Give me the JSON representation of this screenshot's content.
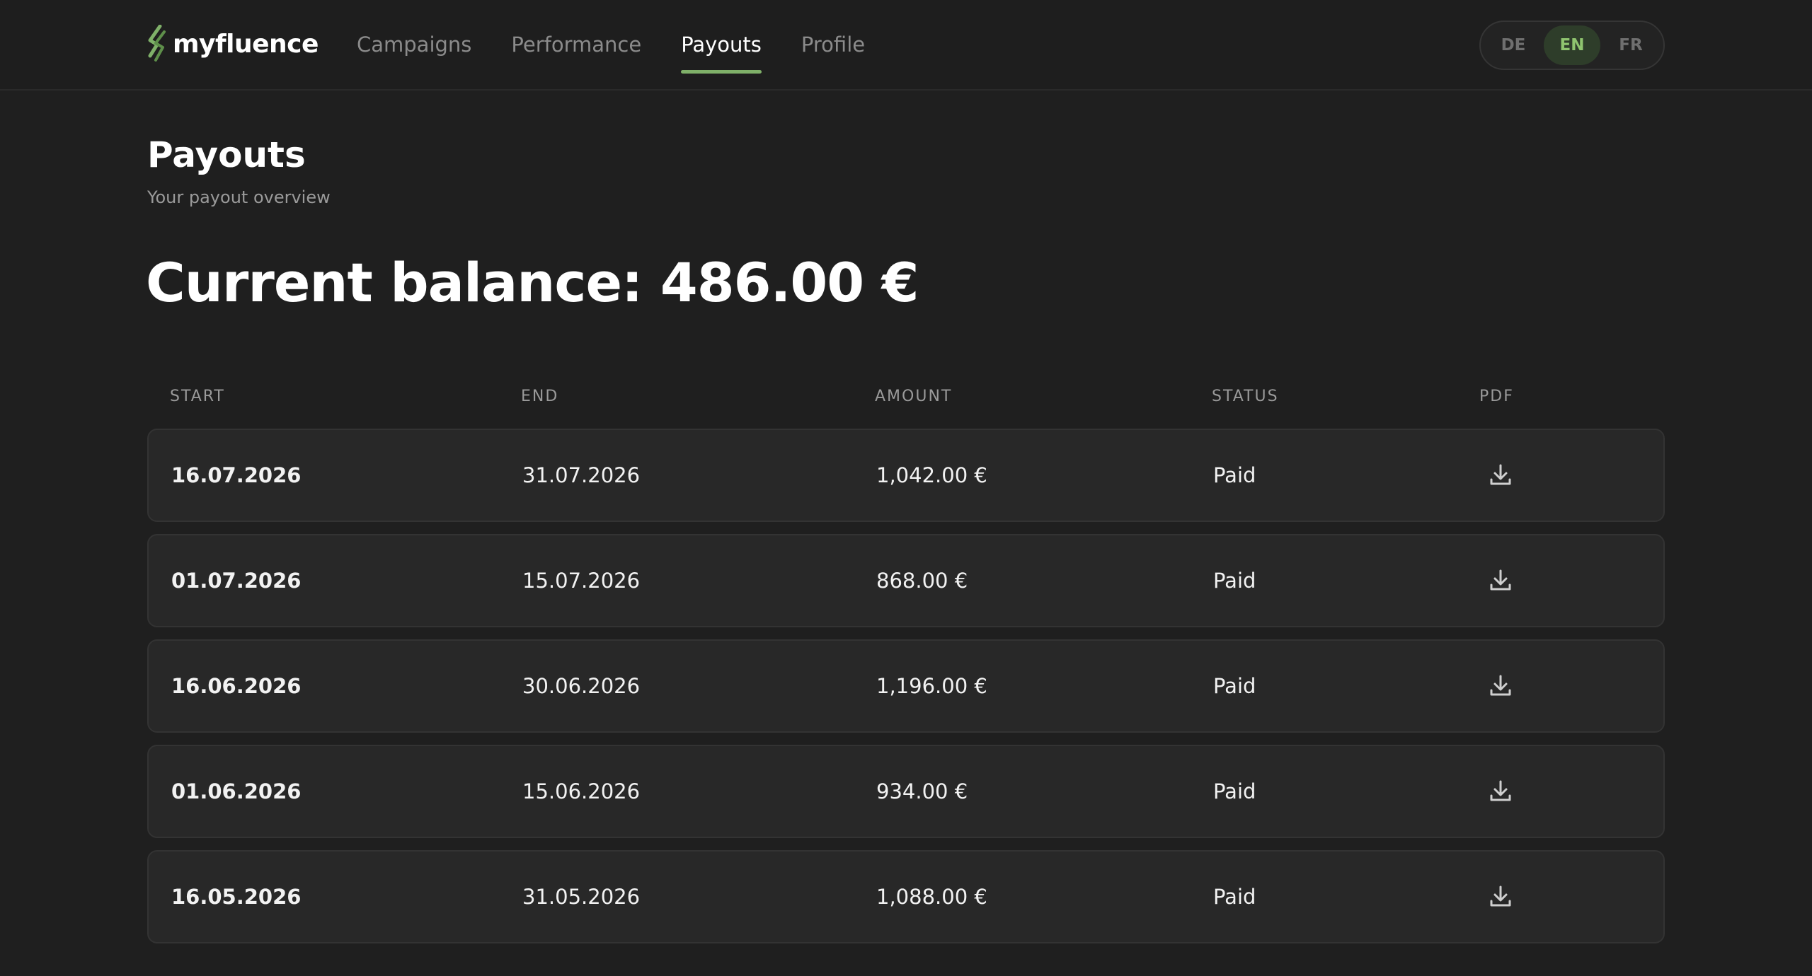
{
  "brand": {
    "name": "myfluence",
    "accent": "#7fb069"
  },
  "nav": {
    "items": [
      {
        "label": "Campaigns",
        "active": false
      },
      {
        "label": "Performance",
        "active": false
      },
      {
        "label": "Payouts",
        "active": true
      },
      {
        "label": "Profile",
        "active": false
      }
    ]
  },
  "lang": {
    "options": [
      "DE",
      "EN",
      "FR"
    ],
    "selected": "EN"
  },
  "page": {
    "title": "Payouts",
    "subtitle": "Your payout overview",
    "balance": "Current balance: 486.00 €"
  },
  "table": {
    "headers": [
      "START",
      "END",
      "AMOUNT",
      "STATUS",
      "PDF"
    ],
    "rows": [
      {
        "start": "16.07.2026",
        "end": "31.07.2026",
        "amount": "1,042.00 €",
        "status": "Paid"
      },
      {
        "start": "01.07.2026",
        "end": "15.07.2026",
        "amount": "868.00 €",
        "status": "Paid"
      },
      {
        "start": "16.06.2026",
        "end": "30.06.2026",
        "amount": "1,196.00 €",
        "status": "Paid"
      },
      {
        "start": "01.06.2026",
        "end": "15.06.2026",
        "amount": "934.00 €",
        "status": "Paid"
      },
      {
        "start": "16.05.2026",
        "end": "31.05.2026",
        "amount": "1,088.00 €",
        "status": "Paid"
      }
    ],
    "pdf_icon": "download-icon"
  }
}
